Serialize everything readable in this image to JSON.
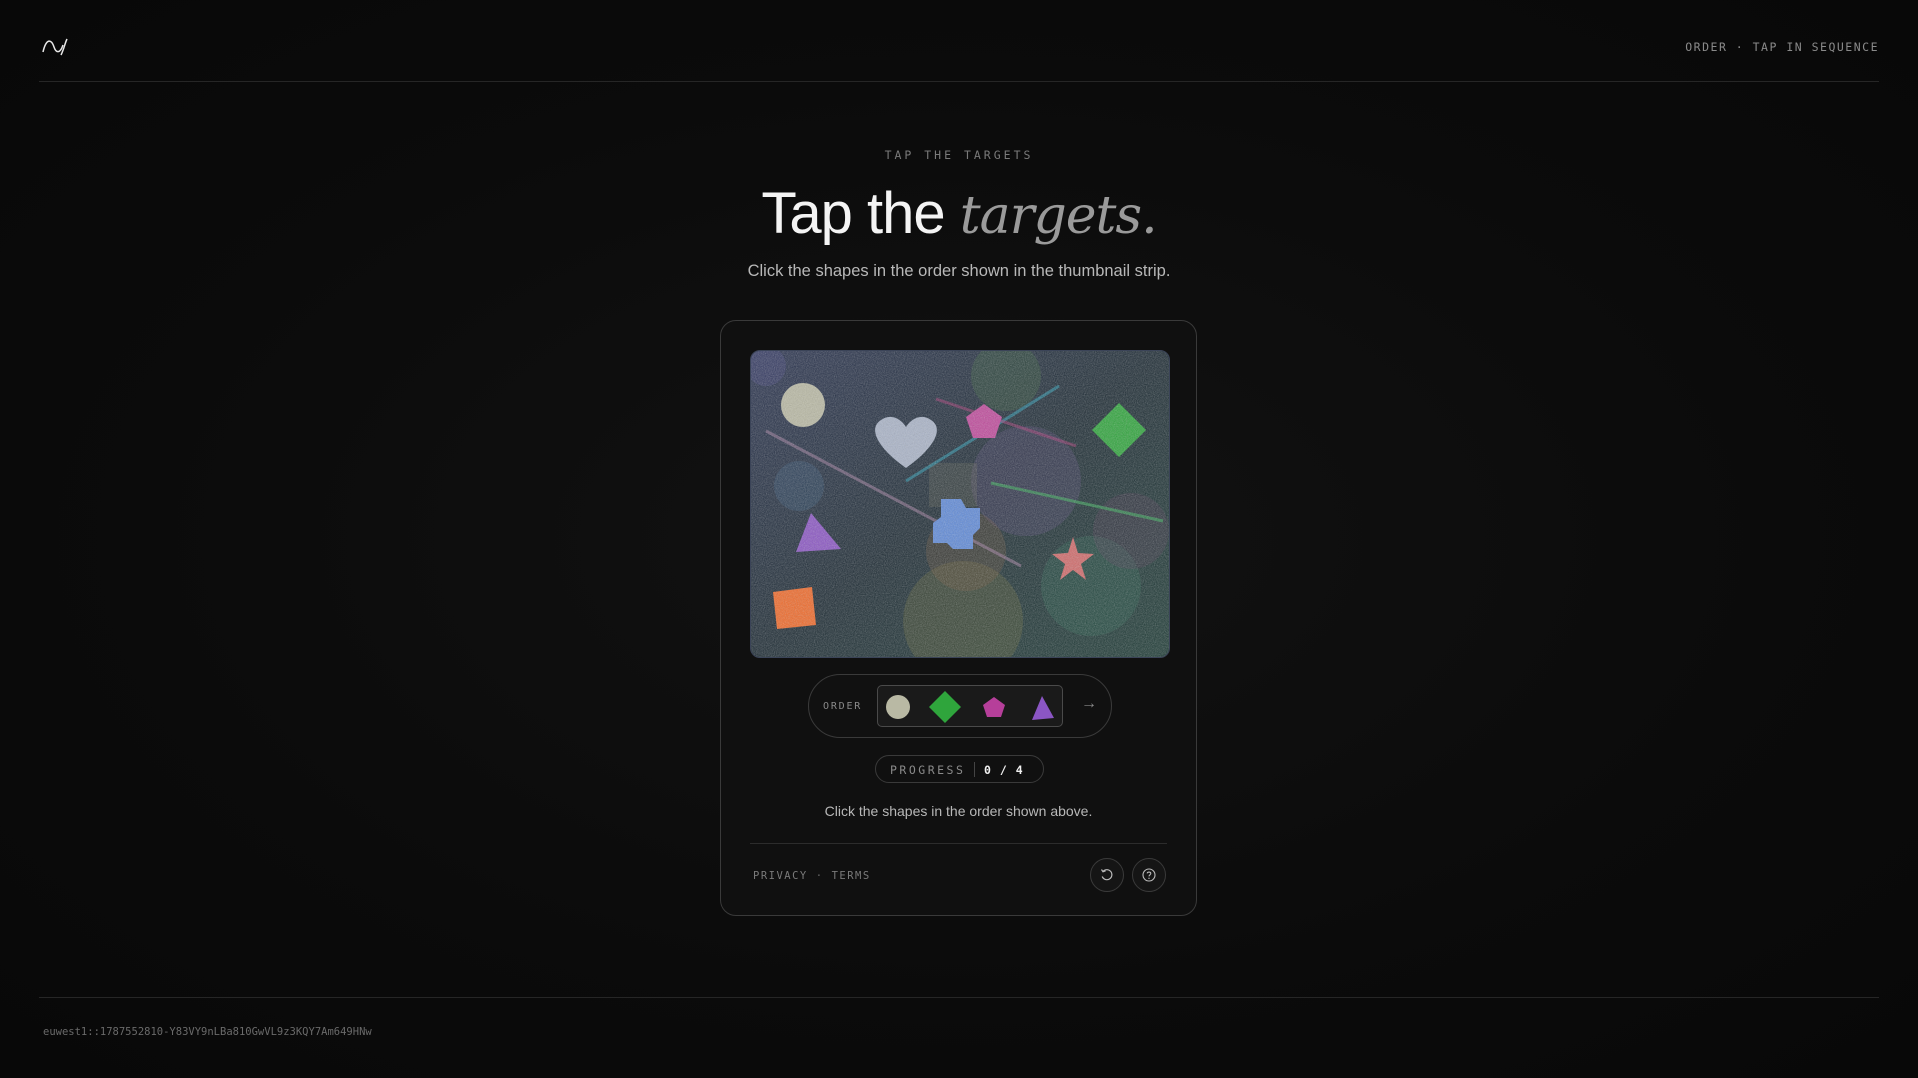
{
  "header": {
    "logo_icon": "wave-logo-icon",
    "meta_text": "ORDER · TAP IN SEQUENCE"
  },
  "hero": {
    "eyebrow": "TAP THE TARGETS",
    "headline_plain": "Tap the ",
    "headline_emphasis": "targets.",
    "subtitle": "Click the shapes in the order shown in the thumbnail strip."
  },
  "challenge": {
    "scene_shapes": [
      "circle",
      "heart",
      "pentagon",
      "diamond",
      "triangle",
      "cross",
      "star",
      "square"
    ],
    "order": {
      "label": "ORDER",
      "thumbnails": [
        {
          "shape": "circle",
          "color": "#b9b9a4"
        },
        {
          "shape": "diamond",
          "color": "#2fa53c"
        },
        {
          "shape": "pentagon",
          "color": "#b63f9a"
        },
        {
          "shape": "triangle",
          "color": "#8b56c4"
        }
      ],
      "arrow": "→"
    },
    "progress": {
      "label": "PROGRESS",
      "value": "0 / 4"
    },
    "instruction": "Click the shapes in the order shown above.",
    "links": {
      "privacy": "PRIVACY",
      "separator": "·",
      "terms": "TERMS"
    },
    "buttons": {
      "refresh_icon": "refresh-icon",
      "help_icon": "help-icon"
    }
  },
  "footer": {
    "session_id": "euwest1::1787552810-Y83VY9nLBa810GwVL9z3KQY7Am649HNw"
  }
}
